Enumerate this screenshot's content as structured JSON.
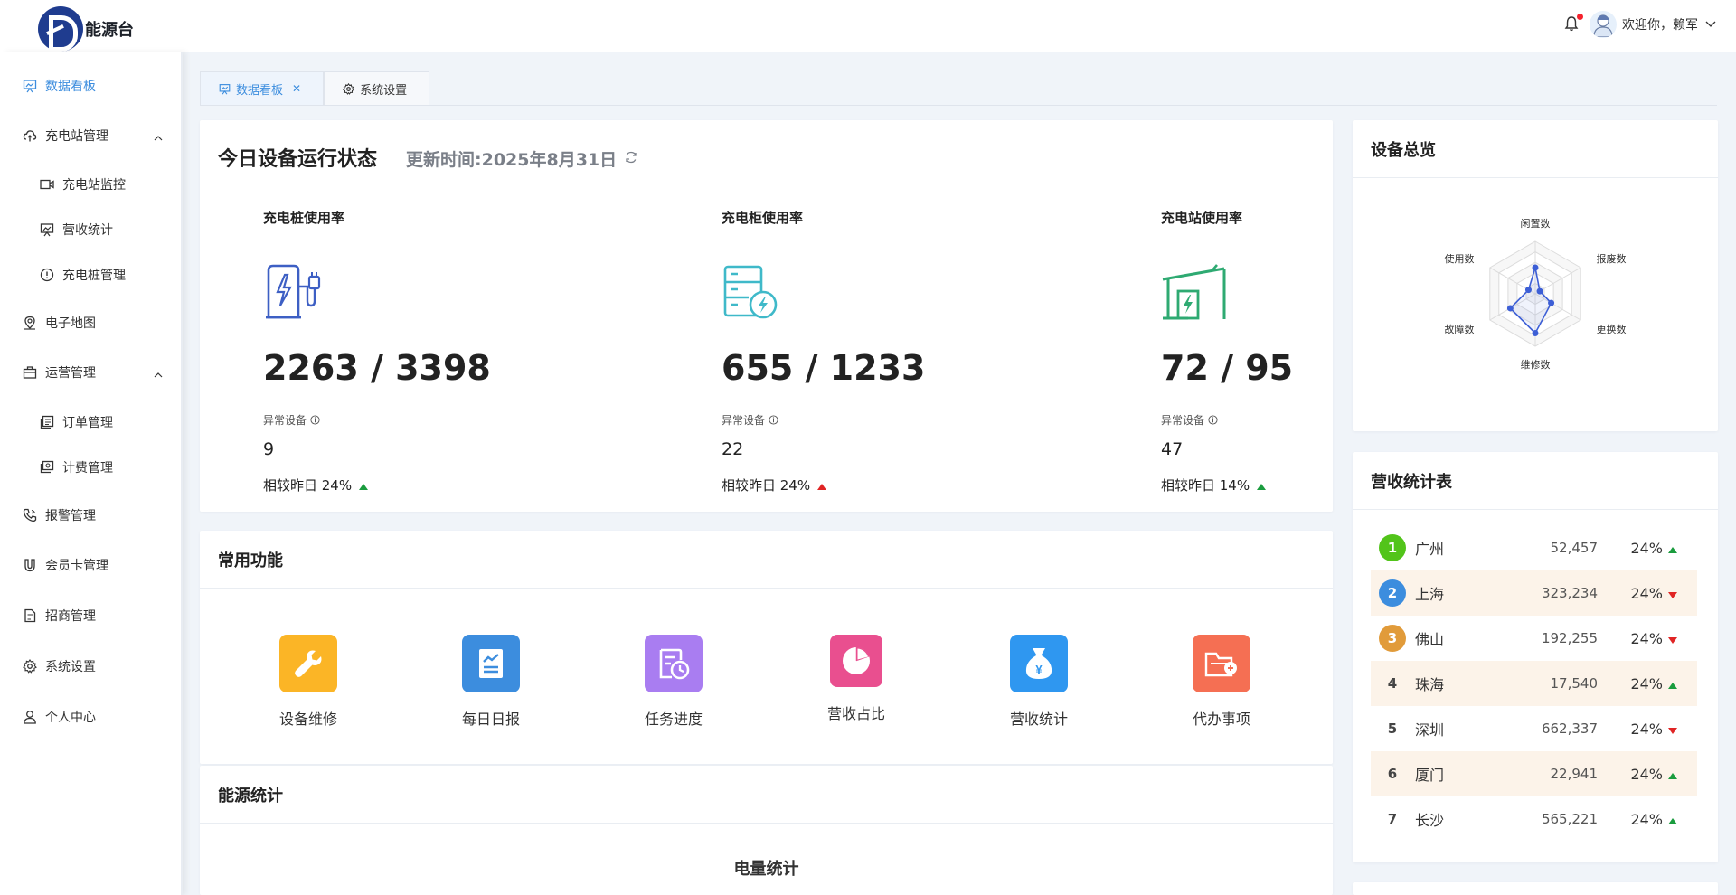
{
  "app": {
    "logo_text": "能源台"
  },
  "header": {
    "greeting": "欢迎你，赖军"
  },
  "sidebar": {
    "items": [
      {
        "label": "数据看板",
        "icon": "dashboard-icon"
      },
      {
        "label": "充电站管理",
        "icon": "cloud-upload-icon"
      },
      {
        "label": "充电站监控",
        "icon": "video-icon"
      },
      {
        "label": "营收统计",
        "icon": "presentation-icon"
      },
      {
        "label": "充电桩管理",
        "icon": "warning-circle-icon"
      },
      {
        "label": "电子地图",
        "icon": "map-pin-icon"
      },
      {
        "label": "运营管理",
        "icon": "briefcase-icon"
      },
      {
        "label": "订单管理",
        "icon": "order-icon"
      },
      {
        "label": "计费管理",
        "icon": "billing-icon"
      },
      {
        "label": "报警管理",
        "icon": "phone-icon"
      },
      {
        "label": "会员卡管理",
        "icon": "magnet-icon"
      },
      {
        "label": "招商管理",
        "icon": "document-icon"
      },
      {
        "label": "系统设置",
        "icon": "gear-icon"
      },
      {
        "label": "个人中心",
        "icon": "user-icon"
      }
    ]
  },
  "tabs": [
    {
      "label": "数据看板",
      "active": true
    },
    {
      "label": "系统设置",
      "active": false
    }
  ],
  "status": {
    "title": "今日设备运行状态",
    "update_time": "更新时间:2025年8月31日",
    "metrics": [
      {
        "label": "充电桩使用率",
        "value": "2263 / 3398",
        "abnormal_label": "异常设备",
        "abnormal_count": "9",
        "compare": "相较昨日 24%",
        "trend": "up",
        "icon": "charging-pile-icon"
      },
      {
        "label": "充电柜使用率",
        "value": "655 / 1233",
        "abnormal_label": "异常设备",
        "abnormal_count": "22",
        "compare": "相较昨日 24%",
        "trend": "up-red",
        "icon": "charging-cabinet-icon"
      },
      {
        "label": "充电站使用率",
        "value": "72 / 95",
        "abnormal_label": "异常设备",
        "abnormal_count": "47",
        "compare": "相较昨日 14%",
        "trend": "up",
        "icon": "charging-station-icon"
      }
    ]
  },
  "functions": {
    "title": "常用功能",
    "items": [
      {
        "label": "设备维修",
        "color": "#fbb526",
        "icon": "wrench-icon"
      },
      {
        "label": "每日日报",
        "color": "#3c8dde",
        "icon": "report-icon"
      },
      {
        "label": "任务进度",
        "color": "#a97df1",
        "icon": "task-icon"
      },
      {
        "label": "营收占比",
        "color": "#e94f8f",
        "icon": "pie-icon"
      },
      {
        "label": "营收统计",
        "color": "#2f97f0",
        "icon": "money-bag-icon"
      },
      {
        "label": "代办事项",
        "color": "#f56f53",
        "icon": "folder-icon"
      }
    ]
  },
  "energy": {
    "title": "能源统计",
    "subtitle": "电量统计"
  },
  "overview": {
    "title": "设备总览",
    "radar_labels": [
      "闲置数",
      "报废数",
      "更换数",
      "维修数",
      "故障数",
      "使用数"
    ],
    "radar_values": [
      0.5,
      0.1,
      0.35,
      0.75,
      0.55,
      0.15
    ]
  },
  "revenue": {
    "title": "营收统计表",
    "rows": [
      {
        "rank": "1",
        "city": "广州",
        "value": "52,457",
        "pct": "24%",
        "trend": "up"
      },
      {
        "rank": "2",
        "city": "上海",
        "value": "323,234",
        "pct": "24%",
        "trend": "down"
      },
      {
        "rank": "3",
        "city": "佛山",
        "value": "192,255",
        "pct": "24%",
        "trend": "down"
      },
      {
        "rank": "4",
        "city": "珠海",
        "value": "17,540",
        "pct": "24%",
        "trend": "up"
      },
      {
        "rank": "5",
        "city": "深圳",
        "value": "662,337",
        "pct": "24%",
        "trend": "down"
      },
      {
        "rank": "6",
        "city": "厦门",
        "value": "22,941",
        "pct": "24%",
        "trend": "up"
      },
      {
        "rank": "7",
        "city": "长沙",
        "value": "565,221",
        "pct": "24%",
        "trend": "up"
      }
    ]
  },
  "colors": {
    "accent": "#3c8dde",
    "up": "#1a9c3e",
    "down": "#e02424",
    "teal": "#3fb9c9",
    "green": "#2eaa72"
  }
}
